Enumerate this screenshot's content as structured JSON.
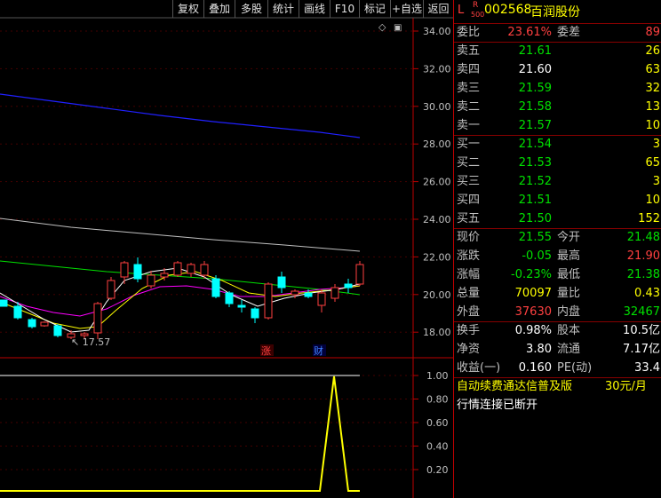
{
  "toolbar": {
    "buttons": [
      "复权",
      "叠加",
      "多股",
      "统计",
      "画线",
      "F10",
      "标记",
      "+自选",
      "返回"
    ]
  },
  "kline": {
    "price_axis": [
      "34.00",
      "32.00",
      "30.00",
      "28.00",
      "26.00",
      "24.00",
      "22.00",
      "20.00",
      "18.00"
    ],
    "low_label": "17.57",
    "tag_up": "涨",
    "tag_fin": "财"
  },
  "indicator": {
    "axis": [
      "1.00",
      "0.80",
      "0.60",
      "0.40",
      "0.20"
    ]
  },
  "quote": {
    "market_l": "L",
    "market_r": "R",
    "market_num": "500",
    "code": "002568",
    "name": "百润股份",
    "weibi_label": "委比",
    "weibi": "23.61%",
    "weicha_label": "委差",
    "weicha": "89",
    "asks": [
      {
        "label": "卖五",
        "price": "21.61",
        "vol": "26"
      },
      {
        "label": "卖四",
        "price": "21.60",
        "vol": "63"
      },
      {
        "label": "卖三",
        "price": "21.59",
        "vol": "32"
      },
      {
        "label": "卖二",
        "price": "21.58",
        "vol": "13"
      },
      {
        "label": "卖一",
        "price": "21.57",
        "vol": "10"
      }
    ],
    "bids": [
      {
        "label": "买一",
        "price": "21.54",
        "vol": "3"
      },
      {
        "label": "买二",
        "price": "21.53",
        "vol": "65"
      },
      {
        "label": "买三",
        "price": "21.52",
        "vol": "3"
      },
      {
        "label": "买四",
        "price": "21.51",
        "vol": "10"
      },
      {
        "label": "买五",
        "price": "21.50",
        "vol": "152"
      }
    ],
    "stats": [
      {
        "l1": "现价",
        "v1": "21.55",
        "l2": "今开",
        "v2": "21.48"
      },
      {
        "l1": "涨跌",
        "v1": "-0.05",
        "l2": "最高",
        "v2": "21.90"
      },
      {
        "l1": "涨幅",
        "v1": "-0.23%",
        "l2": "最低",
        "v2": "21.38"
      },
      {
        "l1": "总量",
        "v1": "70097",
        "l2": "量比",
        "v2": "0.43"
      },
      {
        "l1": "外盘",
        "v1": "37630",
        "l2": "内盘",
        "v2": "32467"
      }
    ],
    "fin": [
      {
        "l1": "换手",
        "v1": "0.98%",
        "l2": "股本",
        "v2": "10.5亿"
      },
      {
        "l1": "净资",
        "v1": "3.80",
        "l2": "流通",
        "v2": "7.17亿"
      },
      {
        "l1": "收益(一)",
        "v1": "0.160",
        "l2": "PE(动)",
        "v2": "33.4"
      }
    ],
    "promo": "自动续费通达信普及版",
    "promo_price": "30元/月",
    "status": "行情连接已断开"
  },
  "colors": {
    "up": "#ff4040",
    "down": "#00ffff",
    "ma_yellow": "#ffff00",
    "ma_magenta": "#ff00ff",
    "ma_green": "#00e000",
    "ma_blue": "#2020ff",
    "ma_gray": "#c0c0c0"
  }
}
